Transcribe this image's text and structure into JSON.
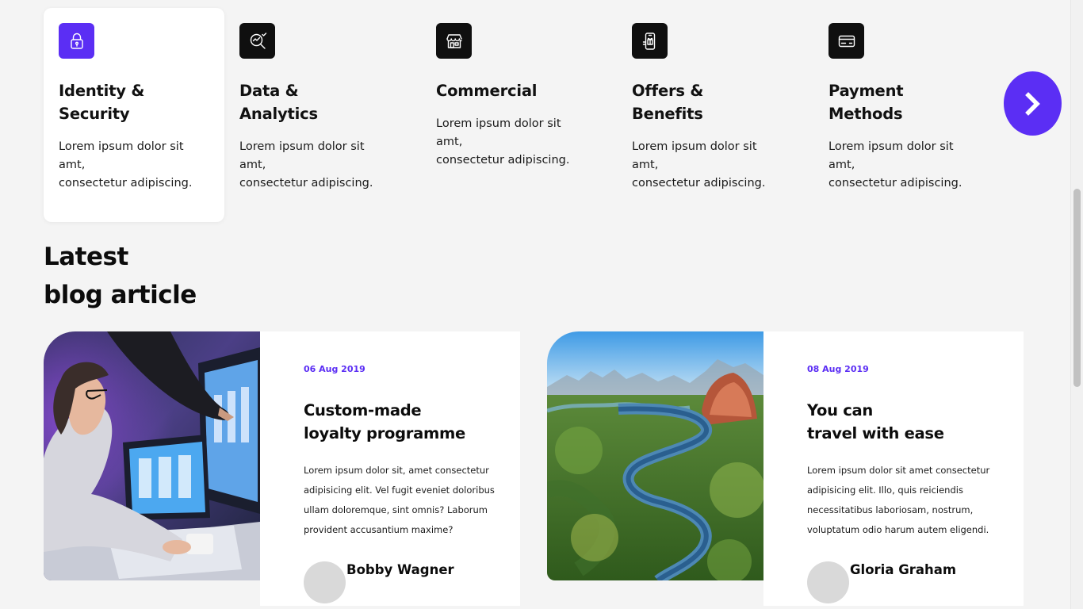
{
  "features": [
    {
      "icon": "padlock-icon",
      "title": "Identity &\nSecurity",
      "description": "Lorem ipsum dolor sit\namt,\nconsectetur adipiscing.",
      "active": true
    },
    {
      "icon": "analytics-magnifier-icon",
      "title": "Data &\nAnalytics",
      "description": "Lorem ipsum dolor sit\namt,\nconsectetur adipiscing.",
      "active": false
    },
    {
      "icon": "storefront-icon",
      "title": "Commercial",
      "description": "Lorem ipsum dolor sit\namt,\nconsectetur adipiscing.",
      "active": false
    },
    {
      "icon": "mobile-offer-icon",
      "title": "Offers &\nBenefits",
      "description": "Lorem ipsum dolor sit\namt,\nconsectetur adipiscing.",
      "active": false
    },
    {
      "icon": "credit-card-icon",
      "title": "Payment\nMethods",
      "description": "Lorem ipsum dolor sit\namt,\nconsectetur adipiscing.",
      "active": false
    }
  ],
  "next_button": {
    "icon": "chevron-right-icon"
  },
  "blog": {
    "heading": "Latest\nblog article",
    "articles": [
      {
        "date": "06 Aug 2019",
        "title": "Custom-made\nloyalty programme",
        "excerpt": "Lorem ipsum dolor sit, amet consectetur adipisicing elit. Vel fugit eveniet doloribus ullam doloremque, sint omnis? Laborum provident accusantium maxime?",
        "author": "Bobby Wagner",
        "image": "woman-at-computer-photo"
      },
      {
        "date": "08 Aug 2019",
        "title": "You can\ntravel with ease",
        "excerpt": "Lorem ipsum dolor sit amet consectetur adipisicing elit. Illo, quis reiciendis necessitatibus laboriosam, nostrum, voluptatum odio harum autem eligendi.",
        "author": "Gloria Graham",
        "image": "river-landscape-photo"
      }
    ]
  },
  "colors": {
    "accent": "#5b2ef4",
    "background": "#f4f4f4",
    "icon_tile": "#0f0f0f"
  }
}
